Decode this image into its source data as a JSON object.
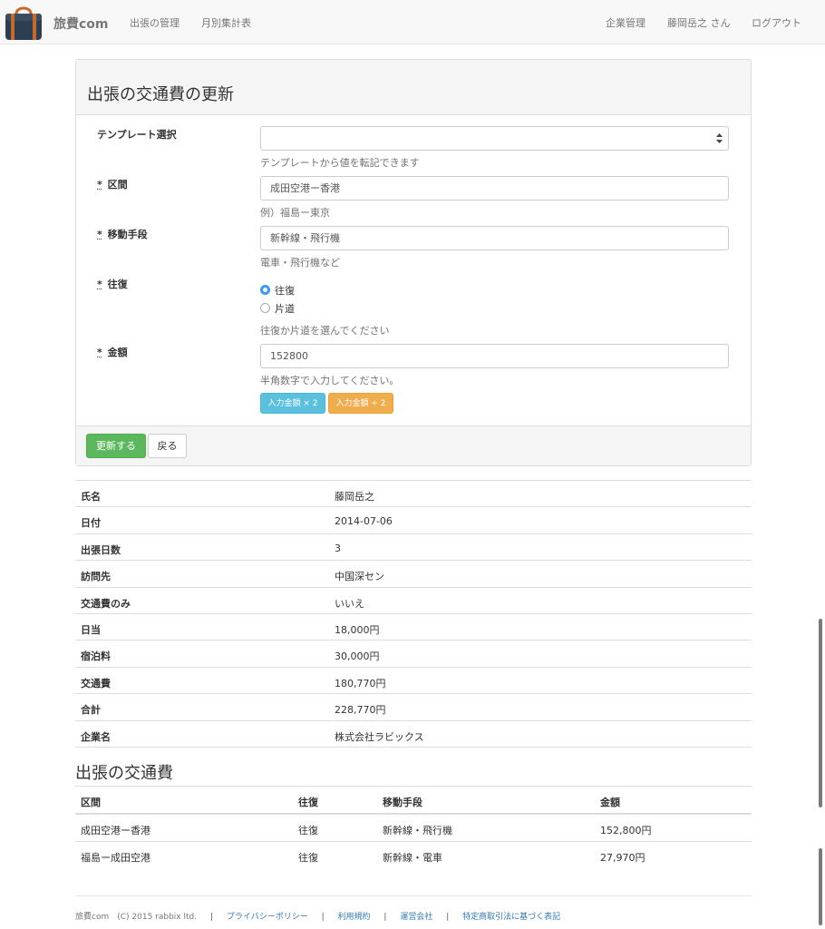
{
  "navbar": {
    "brand": "旅費com",
    "left_links": [
      "出張の管理",
      "月別集計表"
    ],
    "right_links": [
      "企業管理",
      "藤岡岳之 さん",
      "ログアウト"
    ]
  },
  "form": {
    "title": "出張の交通費の更新",
    "template": {
      "label": "テンプレート選択",
      "value": "",
      "help": "テンプレートから値を転記できます"
    },
    "route": {
      "label": "区間",
      "value": "成田空港ー香港",
      "help": "例）福島ー東京"
    },
    "transport": {
      "label": "移動手段",
      "value": "新幹線・飛行機",
      "help": "電車・飛行機など"
    },
    "roundtrip": {
      "label": "往復",
      "options": [
        "往復",
        "片道"
      ],
      "selected": "往復",
      "help": "往復か片道を選んでください"
    },
    "amount": {
      "label": "金額",
      "value": "152800",
      "help": "半角数字で入力してください。",
      "double_button": "入力金額 × 2",
      "half_button": "入力金額 ÷ 2"
    },
    "required_mark": "*",
    "submit_label": "更新する",
    "back_label": "戻る"
  },
  "details": [
    {
      "key": "氏名",
      "value": "藤岡岳之"
    },
    {
      "key": "日付",
      "value": "2014-07-06"
    },
    {
      "key": "出張日数",
      "value": "3"
    },
    {
      "key": "訪問先",
      "value": "中国深セン"
    },
    {
      "key": "交通費のみ",
      "value": "いいえ"
    },
    {
      "key": "日当",
      "value": "18,000円"
    },
    {
      "key": "宿泊料",
      "value": "30,000円"
    },
    {
      "key": "交通費",
      "value": "180,770円"
    },
    {
      "key": "合計",
      "value": "228,770円"
    },
    {
      "key": "企業名",
      "value": "株式会社ラビックス"
    }
  ],
  "fares": {
    "title": "出張の交通費",
    "headers": [
      "区間",
      "往復",
      "移動手段",
      "金額"
    ],
    "rows": [
      [
        "成田空港ー香港",
        "往復",
        "新幹線・飛行機",
        "152,800円"
      ],
      [
        "福島ー成田空港",
        "往復",
        "新幹線・電車",
        "27,970円"
      ]
    ]
  },
  "footer": {
    "copyright": "旅費com　(C) 2015 rabbix ltd.",
    "links": [
      "プライバシーポリシー",
      "利用規約",
      "運営会社",
      "特定商取引法に基づく表記"
    ],
    "separator": "|"
  },
  "colors": {
    "success": "#5cb85c",
    "info": "#5bc0de",
    "warning": "#f0ad4e",
    "link": "#337ab7",
    "radio_checked": "#3b99fc"
  },
  "icons": {
    "logo": "briefcase-logo-icon",
    "select": "select-arrows-icon"
  }
}
